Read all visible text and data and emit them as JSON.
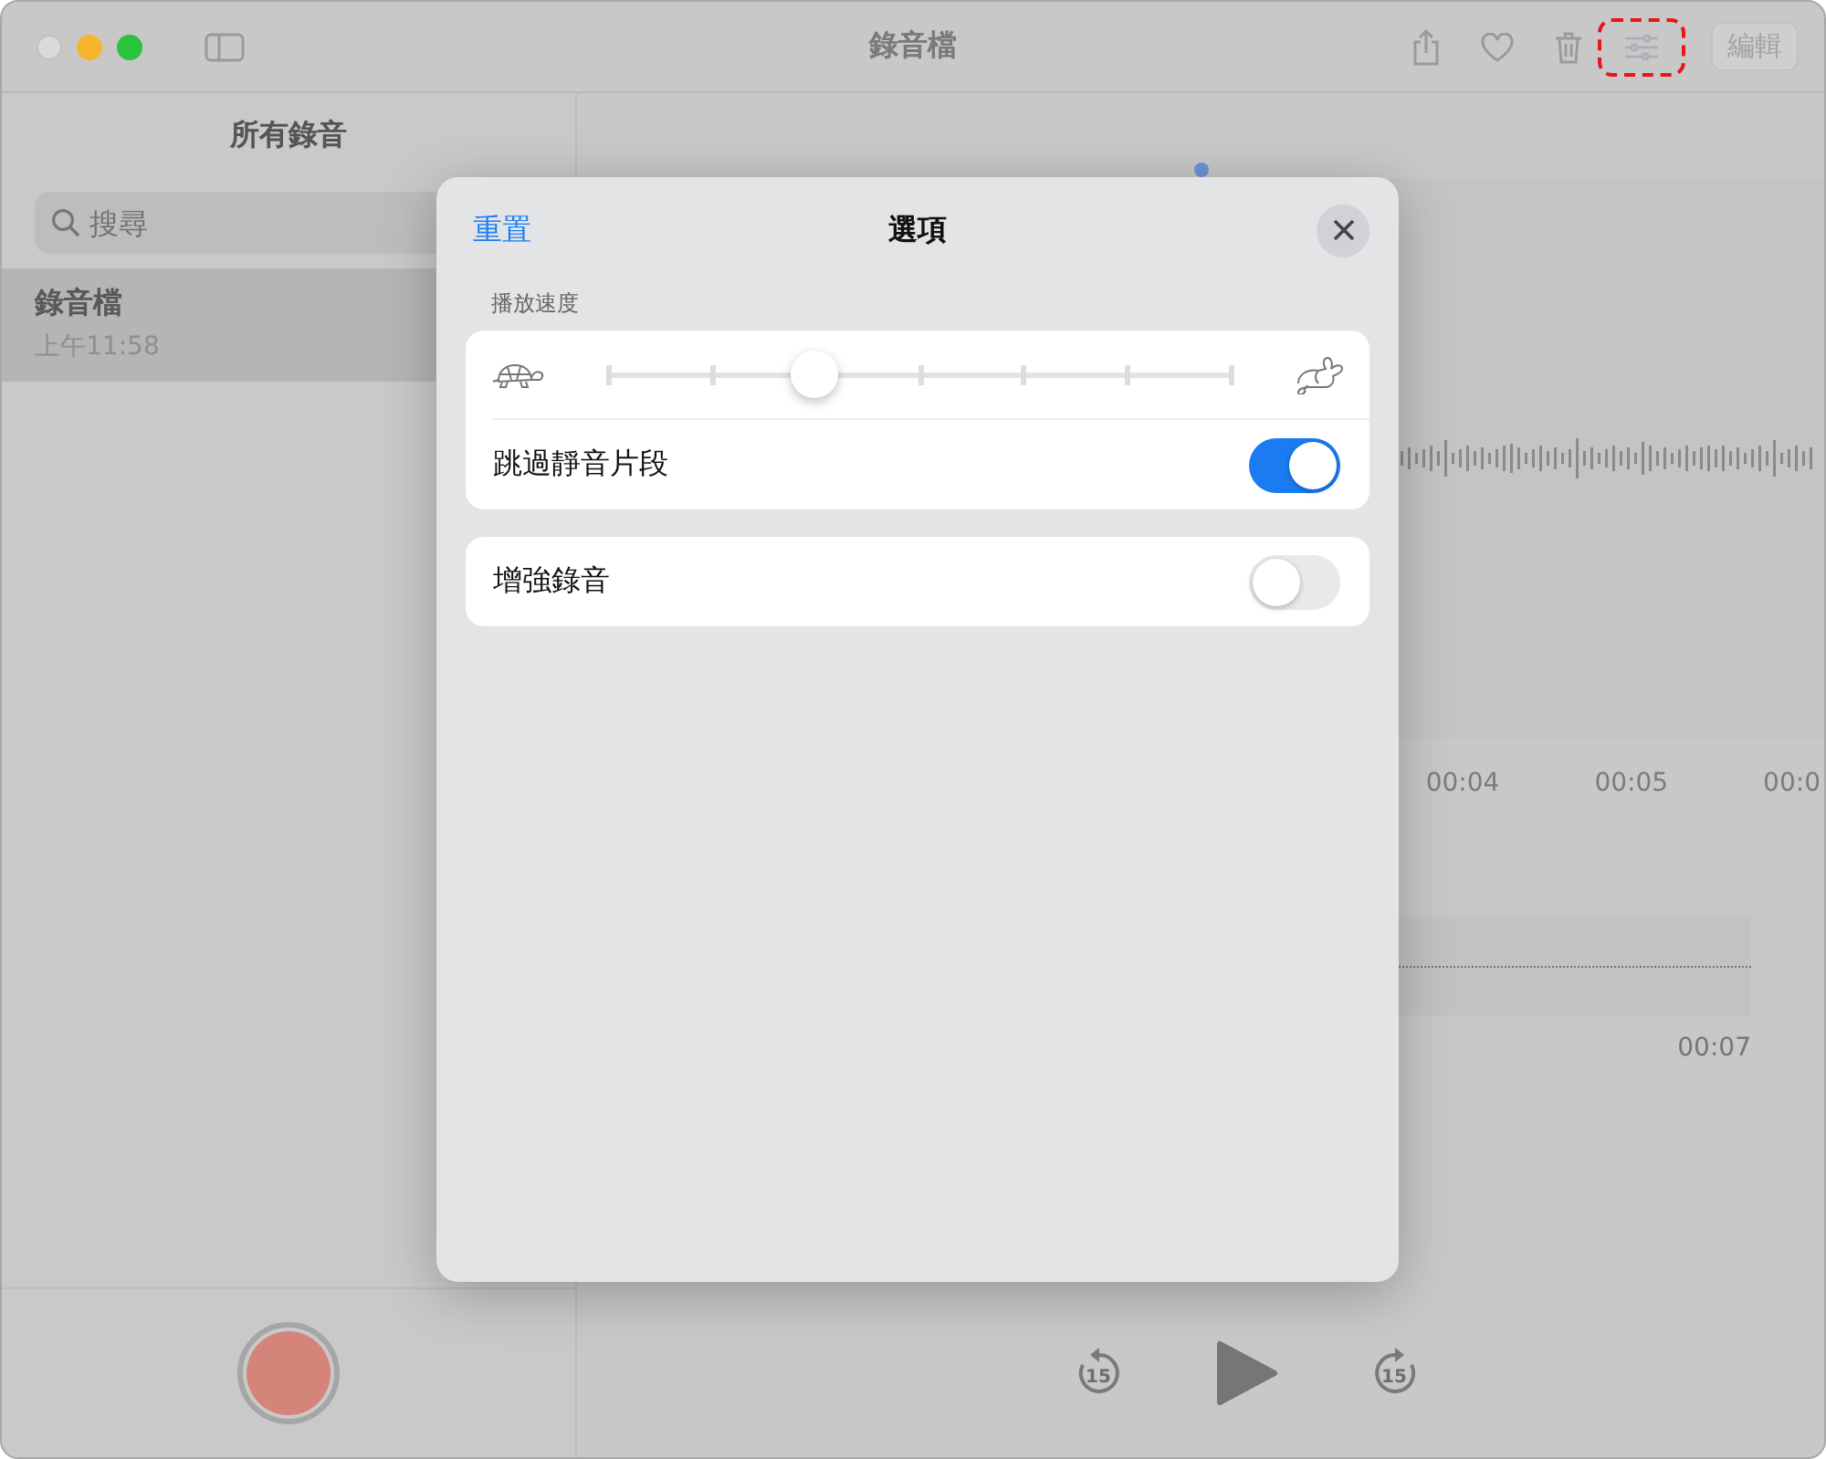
{
  "window": {
    "title": "錄音檔",
    "edit_button": "編輯",
    "options_highlighted": true
  },
  "sidebar": {
    "title": "所有錄音",
    "search": {
      "placeholder": "搜尋"
    },
    "recordings": [
      {
        "title": "錄音檔",
        "time": "上午11:58",
        "selected": true
      }
    ]
  },
  "timeline": {
    "labels": [
      "00:04",
      "00:05",
      "00:0"
    ],
    "overview_time": "00:07"
  },
  "player": {
    "skip_back": "15",
    "skip_forward": "15"
  },
  "options_sheet": {
    "reset": "重置",
    "title": "選項",
    "speed_label": "播放速度",
    "cards": [
      {
        "kind": "speed",
        "level": 0.33,
        "toggles": [
          {
            "label": "跳過靜音片段",
            "on": true
          }
        ]
      },
      {
        "kind": "plain",
        "toggles": [
          {
            "label": "增強錄音",
            "on": false
          }
        ]
      }
    ]
  }
}
